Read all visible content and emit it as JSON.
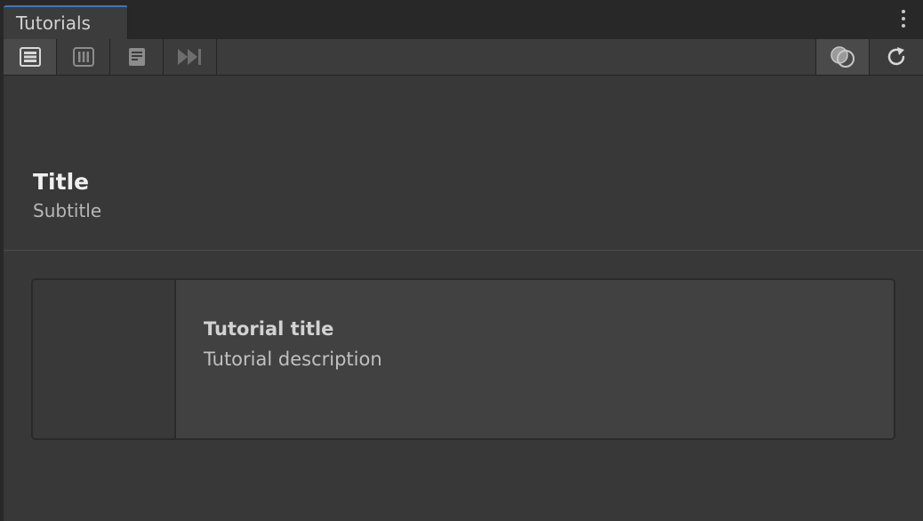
{
  "window": {
    "tab_title": "Tutorials"
  },
  "toolbar": {
    "buttons": [
      {
        "name": "list-view",
        "icon": "list-view-icon",
        "active": true
      },
      {
        "name": "columns-view",
        "icon": "columns-view-icon",
        "active": false
      },
      {
        "name": "document-view",
        "icon": "document-icon",
        "active": false
      },
      {
        "name": "skip-forward",
        "icon": "skip-forward-icon",
        "active": false
      }
    ],
    "right_buttons": [
      {
        "name": "overlay-toggle",
        "icon": "overlap-circles-icon",
        "active": true
      },
      {
        "name": "refresh",
        "icon": "refresh-icon",
        "active": false
      }
    ]
  },
  "header": {
    "title": "Title",
    "subtitle": "Subtitle"
  },
  "cards": [
    {
      "title": "Tutorial title",
      "description": "Tutorial description"
    }
  ],
  "colors": {
    "tab_accent": "#3a79bb",
    "background": "#383838",
    "card": "#414141"
  }
}
